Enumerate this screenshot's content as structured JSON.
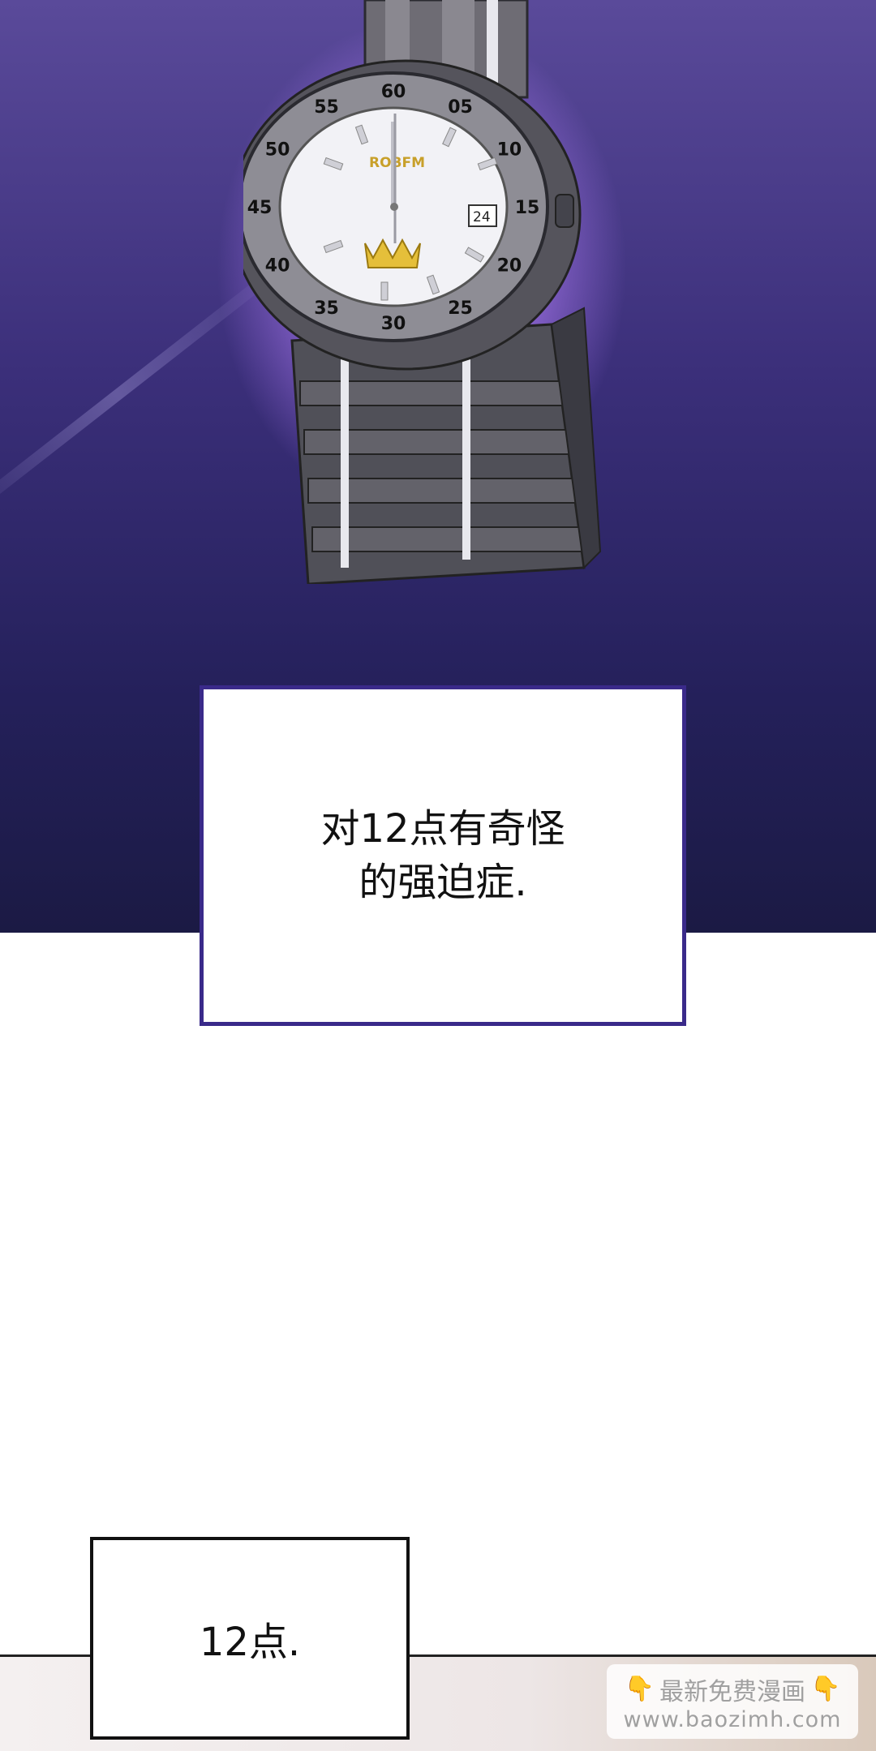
{
  "captions": {
    "main": "对12点有奇怪\n的强迫症.",
    "small": "12点."
  },
  "watch": {
    "brand": "ROBFM",
    "date": "24",
    "bezel_numbers": [
      "60",
      "05",
      "10",
      "15",
      "20",
      "25",
      "30",
      "35",
      "40",
      "45",
      "50",
      "55"
    ]
  },
  "watermark": {
    "line1": "最新免费漫画",
    "line2": "www.baozimh.com",
    "icon": "pointing-down-hand-icon"
  },
  "colors": {
    "frame_accent": "#3a2a8a",
    "background_top": "#3b2f7a"
  }
}
